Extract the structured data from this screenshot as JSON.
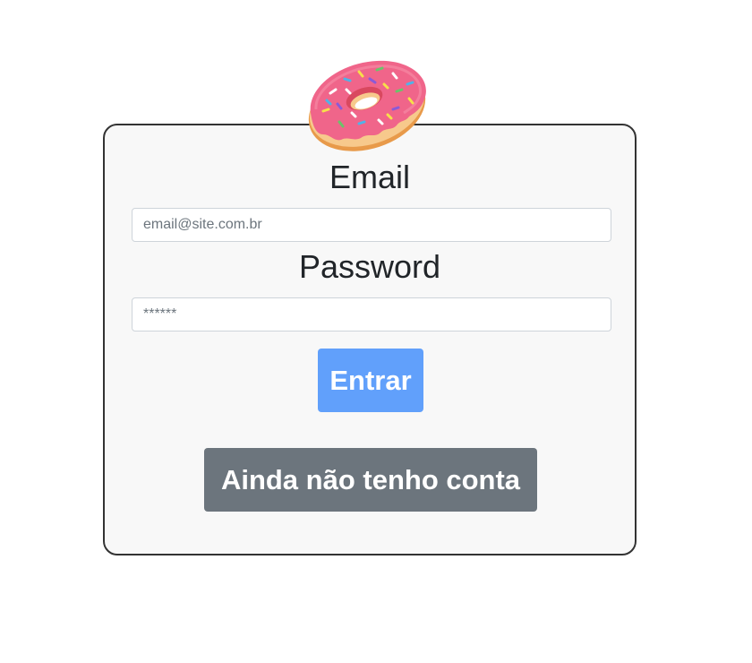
{
  "login_form": {
    "email_label": "Email",
    "email_placeholder": "email@site.com.br",
    "email_value": "",
    "password_label": "Password",
    "password_placeholder": "******",
    "password_value": "",
    "submit_label": "Entrar",
    "signup_label": "Ainda não tenho conta"
  },
  "icons": {
    "logo": "donut-icon"
  },
  "colors": {
    "primary_button": "#61a0fb",
    "secondary_button": "#6c757d",
    "card_background": "#f8f8f8",
    "card_border": "#333333"
  }
}
